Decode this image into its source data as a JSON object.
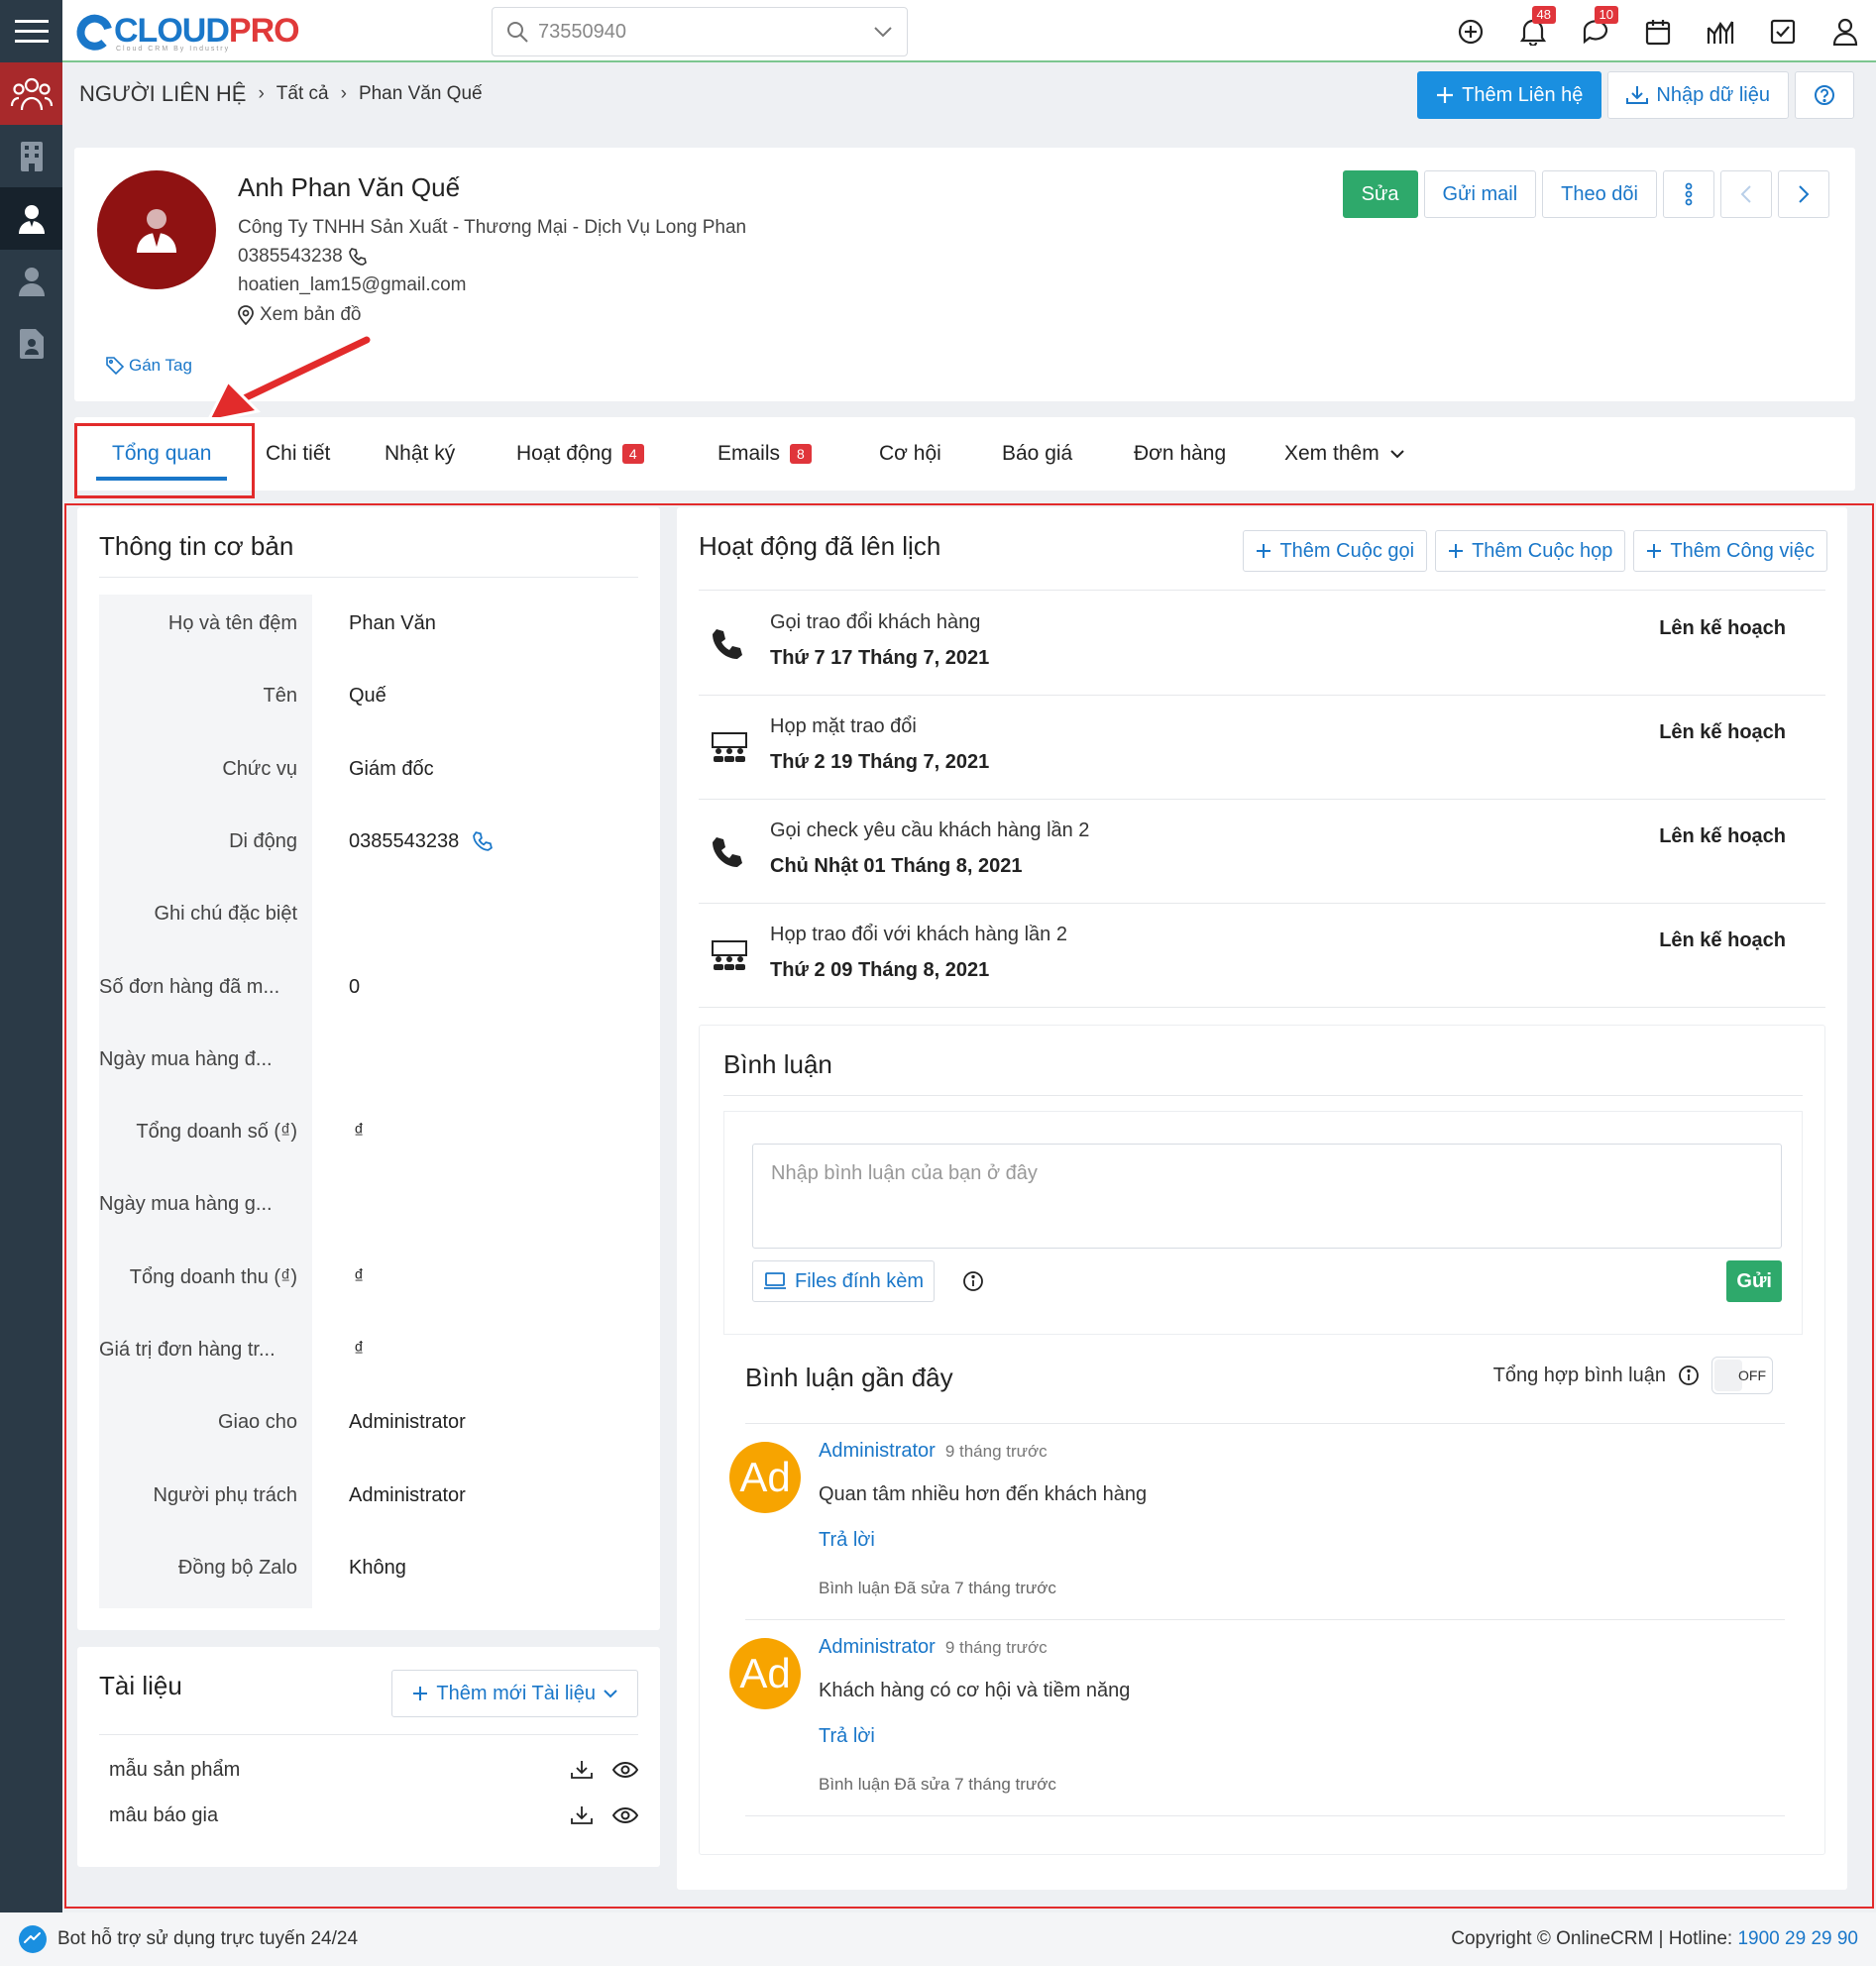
{
  "app": {
    "logo_main": "CLOUD",
    "logo_accent": "PRO",
    "logo_sub": "Cloud CRM By Industry"
  },
  "topbar": {
    "search_value": "73550940",
    "notifications_count": "48",
    "messages_count": "10"
  },
  "breadcrumb": {
    "root": "NGƯỜI LIÊN HỆ",
    "level1": "Tất cả",
    "current": "Phan Văn Quế"
  },
  "header_actions": {
    "add_contact": "Thêm Liên hệ",
    "import": "Nhập dữ liệu"
  },
  "profile": {
    "name": "Anh Phan Văn Quế",
    "company": "Công Ty TNHH Sản Xuất - Thương Mại - Dịch Vụ Long Phan",
    "phone": "0385543238",
    "email": "hoatien_lam15@gmail.com",
    "map_link": "Xem bản đồ",
    "tag_link": "Gán Tag",
    "edit": "Sửa",
    "send_mail": "Gửi mail",
    "follow": "Theo dõi"
  },
  "tabs": {
    "overview": "Tổng quan",
    "details": "Chi tiết",
    "log": "Nhật ký",
    "activities": "Hoạt động",
    "activities_count": "4",
    "emails": "Emails",
    "emails_count": "8",
    "opportunities": "Cơ hội",
    "quotes": "Báo giá",
    "orders": "Đơn hàng",
    "more": "Xem thêm"
  },
  "basic_info": {
    "title": "Thông tin cơ bản",
    "fields": [
      {
        "label": "Họ và tên đệm",
        "value": "Phan Văn"
      },
      {
        "label": "Tên",
        "value": "Quế"
      },
      {
        "label": "Chức vụ",
        "value": "Giám đốc"
      },
      {
        "label": "Di động",
        "value": "0385543238"
      },
      {
        "label": "Ghi chú đặc biệt",
        "value": ""
      },
      {
        "label": "Số đơn hàng đã m...",
        "value": "0"
      },
      {
        "label": "Ngày mua hàng đ...",
        "value": ""
      },
      {
        "label": "Tổng doanh số (₫)",
        "value": "₫"
      },
      {
        "label": "Ngày mua hàng g...",
        "value": ""
      },
      {
        "label": "Tổng doanh thu (₫)",
        "value": "₫"
      },
      {
        "label": "Giá trị đơn hàng tr...",
        "value": "₫"
      },
      {
        "label": "Giao cho",
        "value": "Administrator"
      },
      {
        "label": "Người phụ trách",
        "value": "Administrator"
      },
      {
        "label": "Đồng bộ Zalo",
        "value": "Không"
      }
    ]
  },
  "documents": {
    "title": "Tài liệu",
    "add_button": "Thêm mới Tài liệu",
    "items": [
      "mẫu sản phẩm",
      "mâu báo gia"
    ]
  },
  "scheduled": {
    "title": "Hoạt động đã lên lịch",
    "add_call": "Thêm Cuộc gọi",
    "add_meeting": "Thêm Cuộc họp",
    "add_task": "Thêm Công việc",
    "items": [
      {
        "title": "Gọi trao đổi khách hàng",
        "date": "Thứ 7 17 Tháng 7, 2021",
        "status": "Lên kế hoạch",
        "kind": "call"
      },
      {
        "title": "Họp mặt trao đổi",
        "date": "Thứ 2 19 Tháng 7, 2021",
        "status": "Lên kế hoạch",
        "kind": "meeting"
      },
      {
        "title": "Gọi check yêu cầu khách hàng lần 2",
        "date": "Chủ Nhật 01 Tháng 8, 2021",
        "status": "Lên kế hoạch",
        "kind": "call"
      },
      {
        "title": "Họp trao đổi với khách hàng lần 2",
        "date": "Thứ 2 09 Tháng 8, 2021",
        "status": "Lên kế hoạch",
        "kind": "meeting"
      }
    ]
  },
  "comments": {
    "title": "Bình luận",
    "placeholder": "Nhập bình luận của bạn ở đây",
    "attach": "Files đính kèm",
    "send": "Gửi",
    "recent_title": "Bình luận gần đây",
    "aggregate_label": "Tổng hợp bình luận",
    "toggle_state": "OFF",
    "items": [
      {
        "avatar": "Ad",
        "author": "Administrator",
        "ago": "9 tháng trước",
        "text": "Quan tâm nhiều hơn đến khách hàng",
        "reply": "Trả lời",
        "edited": "Bình luận Đã sửa 7 tháng trước"
      },
      {
        "avatar": "Ad",
        "author": "Administrator",
        "ago": "9 tháng trước",
        "text": "Khách hàng có cơ hội và tiềm năng",
        "reply": "Trả lời",
        "edited": "Bình luận Đã sửa 7 tháng trước"
      }
    ]
  },
  "footer": {
    "bot": "Bot hỗ trợ sử dụng trực tuyến 24/24",
    "copyright": "Copyright © OnlineCRM | Hotline: ",
    "hotline": "1900 29 29 90"
  }
}
